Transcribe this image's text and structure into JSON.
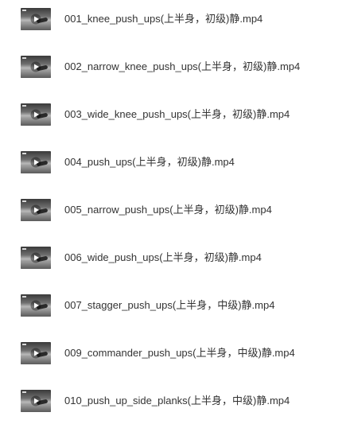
{
  "files": [
    {
      "name": "001_knee_push_ups(上半身，初级)静.mp4",
      "icon": "video-thumbnail-icon"
    },
    {
      "name": "002_narrow_knee_push_ups(上半身，初级)静.mp4",
      "icon": "video-thumbnail-icon"
    },
    {
      "name": "003_wide_knee_push_ups(上半身，初级)静.mp4",
      "icon": "video-thumbnail-icon"
    },
    {
      "name": "004_push_ups(上半身，初级)静.mp4",
      "icon": "video-thumbnail-icon"
    },
    {
      "name": "005_narrow_push_ups(上半身，初级)静.mp4",
      "icon": "video-thumbnail-icon"
    },
    {
      "name": "006_wide_push_ups(上半身，初级)静.mp4",
      "icon": "video-thumbnail-icon"
    },
    {
      "name": "007_stagger_push_ups(上半身，中级)静.mp4",
      "icon": "video-thumbnail-icon"
    },
    {
      "name": "009_commander_push_ups(上半身，中级)静.mp4",
      "icon": "video-thumbnail-icon"
    },
    {
      "name": "010_push_up_side_planks(上半身，中级)静.mp4",
      "icon": "video-thumbnail-icon"
    }
  ]
}
